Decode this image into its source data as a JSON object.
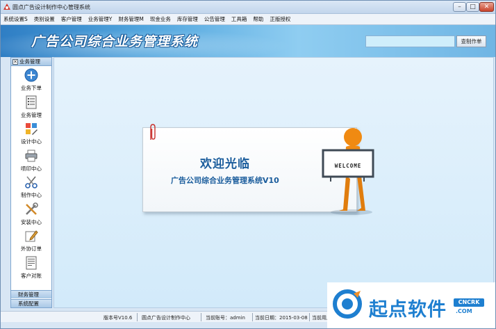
{
  "window": {
    "title": "圆点广告设计制作中心管理系统",
    "min_label": "–",
    "max_label": "□",
    "close_label": "✕"
  },
  "menu": [
    {
      "label": "系统设置S"
    },
    {
      "label": "类别设置"
    },
    {
      "label": "客户管理"
    },
    {
      "label": "业务管理Y"
    },
    {
      "label": "财务管理M"
    },
    {
      "label": "现金业务"
    },
    {
      "label": "库存管理"
    },
    {
      "label": "公告管理"
    },
    {
      "label": "工具箱"
    },
    {
      "label": "帮助"
    },
    {
      "label": "正版授权"
    }
  ],
  "banner": {
    "title": "广告公司综合业务管理系统",
    "search_value": "",
    "search_button": "查制作单"
  },
  "sidebar": {
    "header": "业务管理",
    "header_close": "✕",
    "items": [
      {
        "label": "业务下单",
        "icon": "add-circle-icon"
      },
      {
        "label": "业务管理",
        "icon": "document-list-icon"
      },
      {
        "label": "设计中心",
        "icon": "design-tools-icon"
      },
      {
        "label": "喷印中心",
        "icon": "printer-icon"
      },
      {
        "label": "制作中心",
        "icon": "scissors-icon"
      },
      {
        "label": "安装中心",
        "icon": "wrench-icon"
      },
      {
        "label": "外协订单",
        "icon": "pencil-note-icon"
      },
      {
        "label": "客户对账",
        "icon": "ledger-icon"
      }
    ],
    "footer1": "财务管理",
    "footer2": "系统配置"
  },
  "welcome": {
    "title": "欢迎光临",
    "subtitle": "广告公司综合业务管理系统V10",
    "sign": "WELCOME"
  },
  "status": {
    "version": "版本号V10.6",
    "company": "圆点广告设计制作中心",
    "account": "当前账号：admin",
    "date": "当前日期：2015-03-08",
    "user": "当前用户"
  },
  "watermark": {
    "text": "起点软件",
    "badge": "CNCRK",
    "domain": ".COM"
  },
  "colors": {
    "banner": "#52a6de",
    "welcome_text": "#1a5c9c",
    "watermark": "#1e7fd0"
  }
}
